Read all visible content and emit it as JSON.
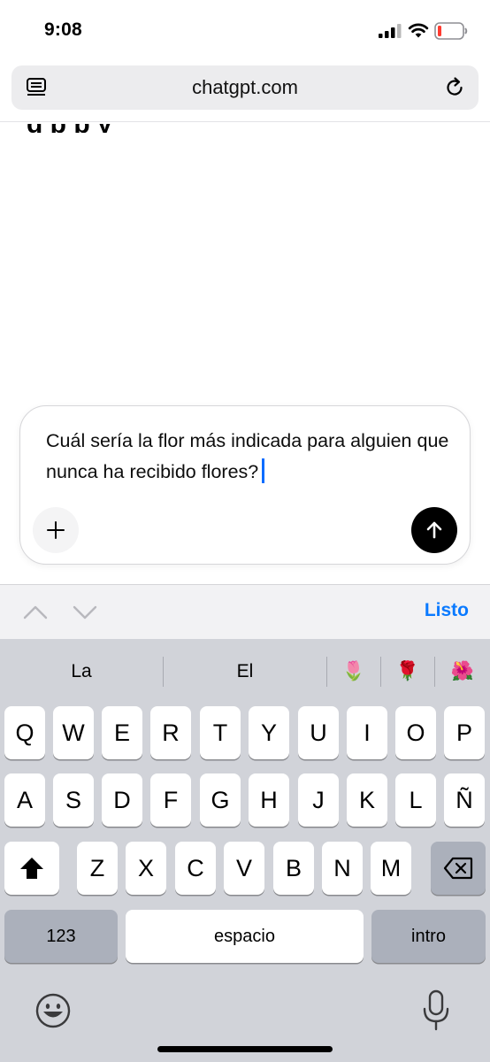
{
  "status_bar": {
    "time": "9:08"
  },
  "browser": {
    "url": "chatgpt.com"
  },
  "chat": {
    "partial_text": "g  p  p  y"
  },
  "composer": {
    "text": "Cuál sería la flor más indicada para alguien que nunca ha recibido flores?"
  },
  "accessory": {
    "done_label": "Listo"
  },
  "keyboard": {
    "suggestions": [
      "La",
      "El",
      "🌷",
      "🌹",
      "🌺"
    ],
    "row1": [
      "Q",
      "W",
      "E",
      "R",
      "T",
      "Y",
      "U",
      "I",
      "O",
      "P"
    ],
    "row2": [
      "A",
      "S",
      "D",
      "F",
      "G",
      "H",
      "J",
      "K",
      "L",
      "Ñ"
    ],
    "row3": [
      "Z",
      "X",
      "C",
      "V",
      "B",
      "N",
      "M"
    ],
    "numbers_label": "123",
    "space_label": "espacio",
    "return_label": "intro"
  },
  "colors": {
    "accent": "#0a7aff",
    "keyboard_bg": "#d1d3d9",
    "battery_low": "#ff3b30"
  }
}
